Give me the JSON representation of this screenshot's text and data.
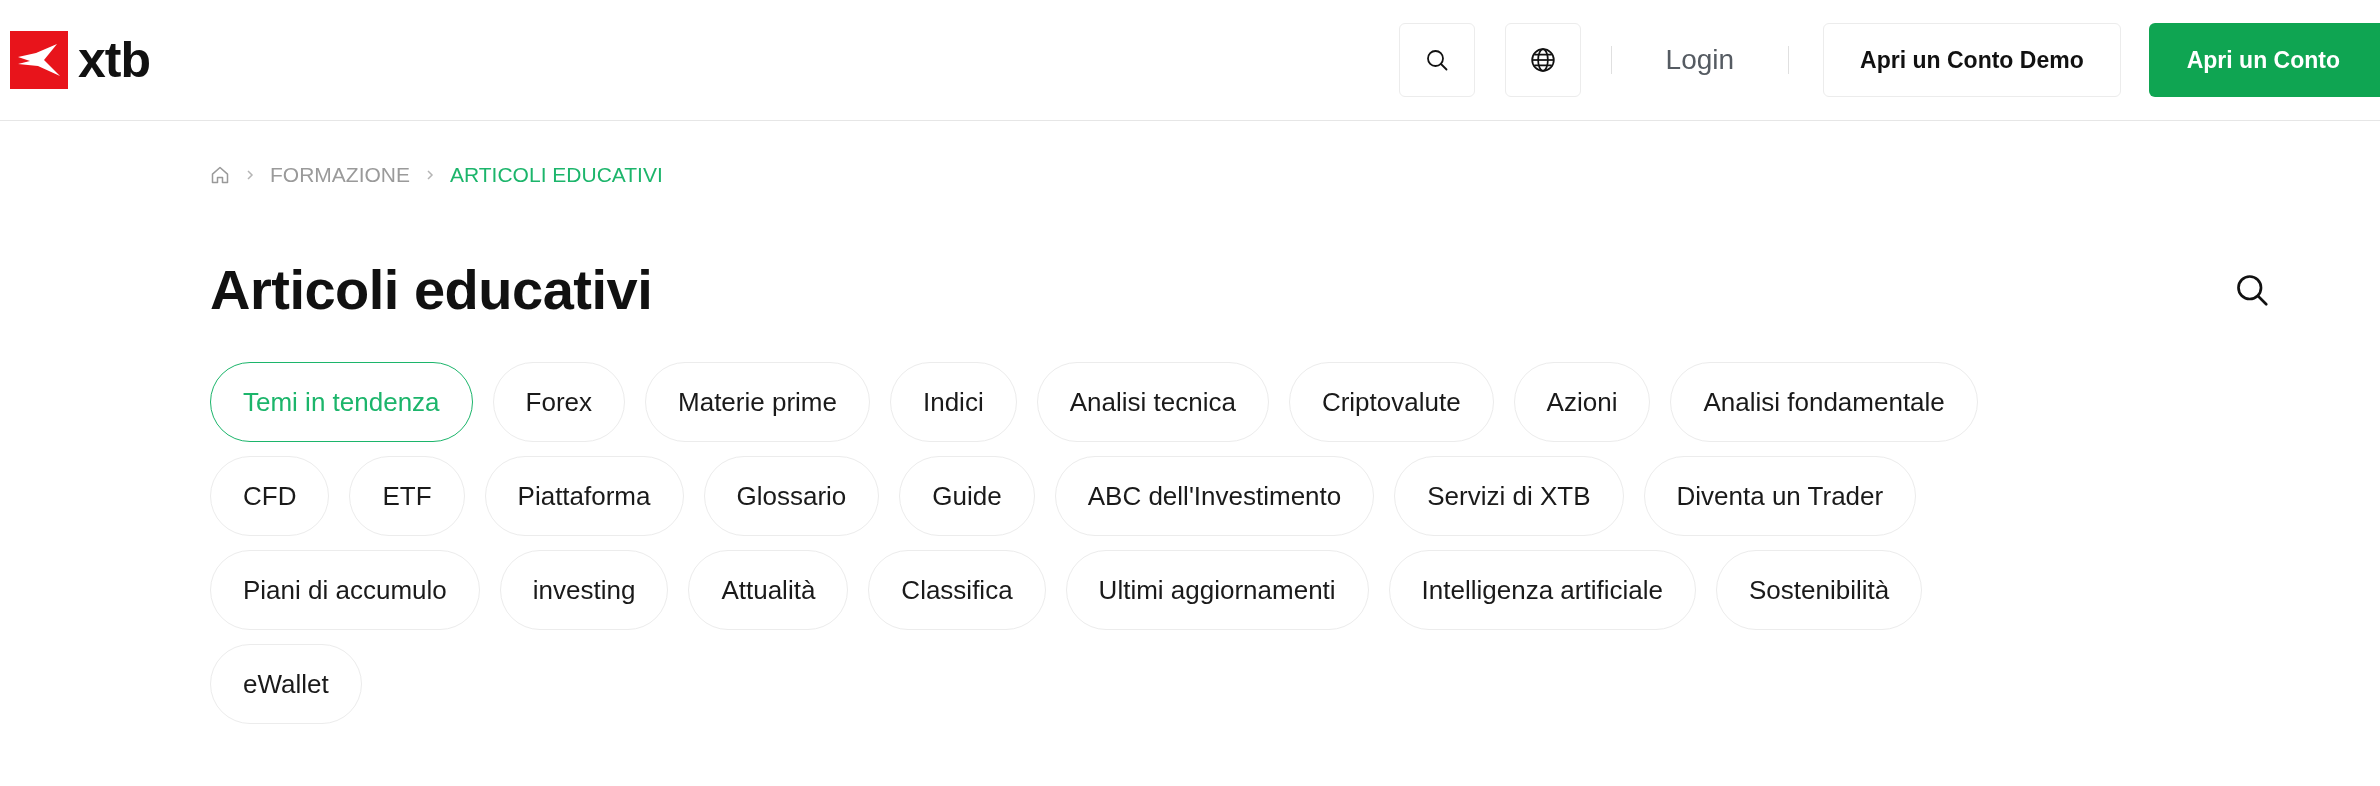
{
  "header": {
    "logo_text": "xtb",
    "login": "Login",
    "demo_button": "Apri un Conto Demo",
    "open_button": "Apri un Conto"
  },
  "breadcrumb": [
    {
      "label": "FORMAZIONE",
      "selected": false
    },
    {
      "label": "ARTICOLI EDUCATIVI",
      "selected": true
    }
  ],
  "title": "Articoli educativi",
  "categories": [
    {
      "label": "Temi in tendenza",
      "selected": true
    },
    {
      "label": "Forex",
      "selected": false
    },
    {
      "label": "Materie prime",
      "selected": false
    },
    {
      "label": "Indici",
      "selected": false
    },
    {
      "label": "Analisi tecnica",
      "selected": false
    },
    {
      "label": "Criptovalute",
      "selected": false
    },
    {
      "label": "Azioni",
      "selected": false
    },
    {
      "label": "Analisi fondamentale",
      "selected": false
    },
    {
      "label": "CFD",
      "selected": false
    },
    {
      "label": "ETF",
      "selected": false
    },
    {
      "label": "Piattaforma",
      "selected": false
    },
    {
      "label": "Glossario",
      "selected": false
    },
    {
      "label": "Guide",
      "selected": false
    },
    {
      "label": "ABC dell'Investimento",
      "selected": false
    },
    {
      "label": "Servizi di XTB",
      "selected": false
    },
    {
      "label": "Diventa un Trader",
      "selected": false
    },
    {
      "label": "Piani di accumulo",
      "selected": false
    },
    {
      "label": "investing",
      "selected": false
    },
    {
      "label": "Attualità",
      "selected": false
    },
    {
      "label": "Classifica",
      "selected": false
    },
    {
      "label": "Ultimi aggiornamenti",
      "selected": false
    },
    {
      "label": "Intelligenza artificiale",
      "selected": false
    },
    {
      "label": "Sostenibilità",
      "selected": false
    },
    {
      "label": "eWallet",
      "selected": false
    }
  ]
}
